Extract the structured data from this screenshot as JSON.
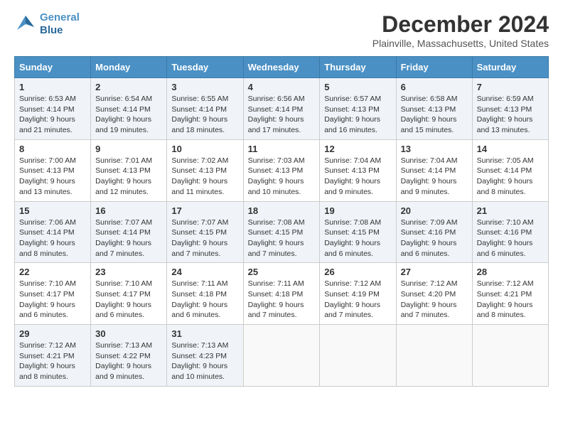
{
  "logo": {
    "line1": "General",
    "line2": "Blue"
  },
  "title": "December 2024",
  "subtitle": "Plainville, Massachusetts, United States",
  "weekdays": [
    "Sunday",
    "Monday",
    "Tuesday",
    "Wednesday",
    "Thursday",
    "Friday",
    "Saturday"
  ],
  "weeks": [
    [
      {
        "day": "1",
        "sunrise": "6:53 AM",
        "sunset": "4:14 PM",
        "daylight": "9 hours and 21 minutes."
      },
      {
        "day": "2",
        "sunrise": "6:54 AM",
        "sunset": "4:14 PM",
        "daylight": "9 hours and 19 minutes."
      },
      {
        "day": "3",
        "sunrise": "6:55 AM",
        "sunset": "4:14 PM",
        "daylight": "9 hours and 18 minutes."
      },
      {
        "day": "4",
        "sunrise": "6:56 AM",
        "sunset": "4:14 PM",
        "daylight": "9 hours and 17 minutes."
      },
      {
        "day": "5",
        "sunrise": "6:57 AM",
        "sunset": "4:13 PM",
        "daylight": "9 hours and 16 minutes."
      },
      {
        "day": "6",
        "sunrise": "6:58 AM",
        "sunset": "4:13 PM",
        "daylight": "9 hours and 15 minutes."
      },
      {
        "day": "7",
        "sunrise": "6:59 AM",
        "sunset": "4:13 PM",
        "daylight": "9 hours and 13 minutes."
      }
    ],
    [
      {
        "day": "8",
        "sunrise": "7:00 AM",
        "sunset": "4:13 PM",
        "daylight": "9 hours and 13 minutes."
      },
      {
        "day": "9",
        "sunrise": "7:01 AM",
        "sunset": "4:13 PM",
        "daylight": "9 hours and 12 minutes."
      },
      {
        "day": "10",
        "sunrise": "7:02 AM",
        "sunset": "4:13 PM",
        "daylight": "9 hours and 11 minutes."
      },
      {
        "day": "11",
        "sunrise": "7:03 AM",
        "sunset": "4:13 PM",
        "daylight": "9 hours and 10 minutes."
      },
      {
        "day": "12",
        "sunrise": "7:04 AM",
        "sunset": "4:13 PM",
        "daylight": "9 hours and 9 minutes."
      },
      {
        "day": "13",
        "sunrise": "7:04 AM",
        "sunset": "4:14 PM",
        "daylight": "9 hours and 9 minutes."
      },
      {
        "day": "14",
        "sunrise": "7:05 AM",
        "sunset": "4:14 PM",
        "daylight": "9 hours and 8 minutes."
      }
    ],
    [
      {
        "day": "15",
        "sunrise": "7:06 AM",
        "sunset": "4:14 PM",
        "daylight": "9 hours and 8 minutes."
      },
      {
        "day": "16",
        "sunrise": "7:07 AM",
        "sunset": "4:14 PM",
        "daylight": "9 hours and 7 minutes."
      },
      {
        "day": "17",
        "sunrise": "7:07 AM",
        "sunset": "4:15 PM",
        "daylight": "9 hours and 7 minutes."
      },
      {
        "day": "18",
        "sunrise": "7:08 AM",
        "sunset": "4:15 PM",
        "daylight": "9 hours and 7 minutes."
      },
      {
        "day": "19",
        "sunrise": "7:08 AM",
        "sunset": "4:15 PM",
        "daylight": "9 hours and 6 minutes."
      },
      {
        "day": "20",
        "sunrise": "7:09 AM",
        "sunset": "4:16 PM",
        "daylight": "9 hours and 6 minutes."
      },
      {
        "day": "21",
        "sunrise": "7:10 AM",
        "sunset": "4:16 PM",
        "daylight": "9 hours and 6 minutes."
      }
    ],
    [
      {
        "day": "22",
        "sunrise": "7:10 AM",
        "sunset": "4:17 PM",
        "daylight": "9 hours and 6 minutes."
      },
      {
        "day": "23",
        "sunrise": "7:10 AM",
        "sunset": "4:17 PM",
        "daylight": "9 hours and 6 minutes."
      },
      {
        "day": "24",
        "sunrise": "7:11 AM",
        "sunset": "4:18 PM",
        "daylight": "9 hours and 6 minutes."
      },
      {
        "day": "25",
        "sunrise": "7:11 AM",
        "sunset": "4:18 PM",
        "daylight": "9 hours and 7 minutes."
      },
      {
        "day": "26",
        "sunrise": "7:12 AM",
        "sunset": "4:19 PM",
        "daylight": "9 hours and 7 minutes."
      },
      {
        "day": "27",
        "sunrise": "7:12 AM",
        "sunset": "4:20 PM",
        "daylight": "9 hours and 7 minutes."
      },
      {
        "day": "28",
        "sunrise": "7:12 AM",
        "sunset": "4:21 PM",
        "daylight": "9 hours and 8 minutes."
      }
    ],
    [
      {
        "day": "29",
        "sunrise": "7:12 AM",
        "sunset": "4:21 PM",
        "daylight": "9 hours and 8 minutes."
      },
      {
        "day": "30",
        "sunrise": "7:13 AM",
        "sunset": "4:22 PM",
        "daylight": "9 hours and 9 minutes."
      },
      {
        "day": "31",
        "sunrise": "7:13 AM",
        "sunset": "4:23 PM",
        "daylight": "9 hours and 10 minutes."
      },
      null,
      null,
      null,
      null
    ]
  ]
}
